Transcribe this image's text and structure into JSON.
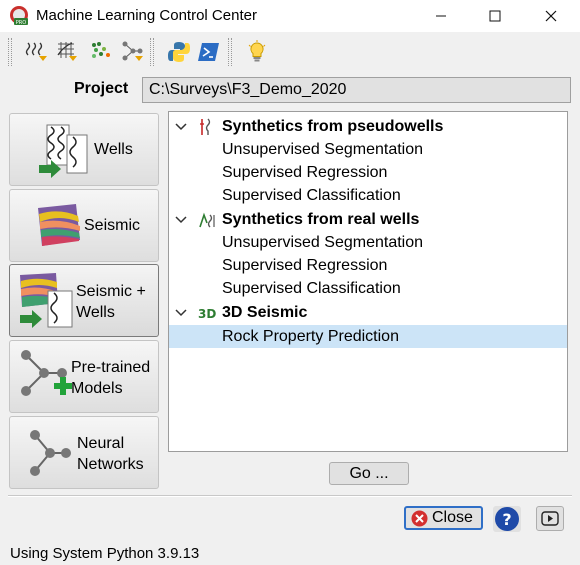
{
  "window": {
    "title": "Machine Learning Control Center"
  },
  "project": {
    "label": "Project",
    "path": "C:\\Surveys\\F3_Demo_2020"
  },
  "sidebar": {
    "items": [
      {
        "label_line1": "Wells",
        "label_line2": ""
      },
      {
        "label_line1": "Seismic",
        "label_line2": ""
      },
      {
        "label_line1": "Seismic +",
        "label_line2": "Wells"
      },
      {
        "label_line1": "Pre-trained",
        "label_line2": "Models"
      },
      {
        "label_line1": "Neural",
        "label_line2": "Networks"
      }
    ]
  },
  "tree": {
    "groups": [
      {
        "title": "Synthetics from pseudowells",
        "icon": "pseudowell-icon",
        "items": [
          "Unsupervised Segmentation",
          "Supervised Regression",
          "Supervised Classification"
        ]
      },
      {
        "title": "Synthetics from real wells",
        "icon": "realwell-icon",
        "items": [
          "Unsupervised Segmentation",
          "Supervised Regression",
          "Supervised Classification"
        ]
      },
      {
        "title": "3D Seismic",
        "icon": "3d-seismic-icon",
        "items": [
          "Rock Property Prediction"
        ]
      }
    ],
    "selected": "Rock Property Prediction",
    "icon_3d_text": "3D"
  },
  "buttons": {
    "go": "Go ...",
    "close": "Close"
  },
  "status": {
    "text": "Using System Python 3.9.13"
  },
  "colors": {
    "selection": "#cce4f7",
    "accent": "#2f6fc7",
    "help": "#1f4aa8",
    "green": "#27a844"
  }
}
